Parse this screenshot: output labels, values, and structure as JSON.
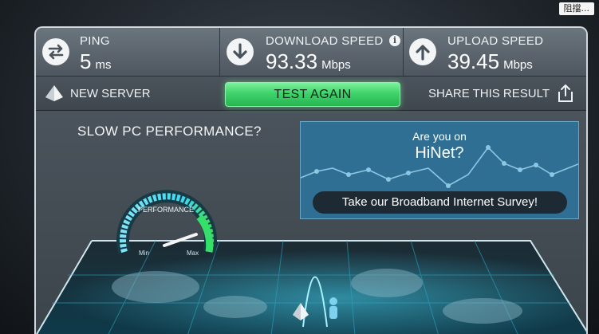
{
  "corner_badge": "阻擋...",
  "stats": {
    "ping": {
      "label": "PING",
      "value": "5",
      "unit": "ms",
      "icon": "swap-arrows-icon"
    },
    "download": {
      "label": "DOWNLOAD SPEED",
      "value": "93.33",
      "unit": "Mbps",
      "icon": "arrow-down-icon"
    },
    "upload": {
      "label": "UPLOAD SPEED",
      "value": "39.45",
      "unit": "Mbps",
      "icon": "arrow-up-icon"
    }
  },
  "actions": {
    "new_server": "NEW SERVER",
    "test_again": "TEST AGAIN",
    "share": "SHARE THIS RESULT"
  },
  "promo": {
    "title": "SLOW PC PERFORMANCE?",
    "gauge_label": "PERFORMANCE",
    "gauge_min": "Min",
    "gauge_max": "Max"
  },
  "ad": {
    "line1": "Are you on",
    "line2": "HiNet?",
    "button": "Take our Broadband Internet Survey!"
  },
  "colors": {
    "accent_green": "#3fd36b",
    "ad_blue": "#2f6f93",
    "gauge_glow": "#3ad9f0"
  }
}
